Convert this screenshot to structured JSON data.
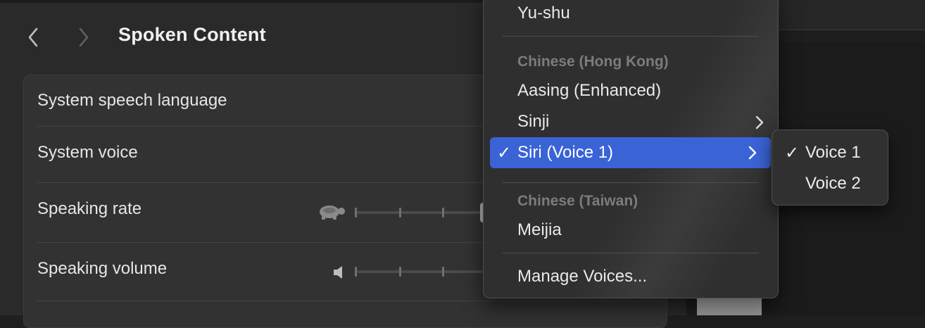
{
  "window": {
    "title": "Spoken Content",
    "back_icon": "chevron-left-icon",
    "forward_icon": "chevron-right-icon"
  },
  "settings": {
    "rows": [
      {
        "label": "System speech language"
      },
      {
        "label": "System voice"
      },
      {
        "label": "Speaking rate",
        "icon": "turtle-icon"
      },
      {
        "label": "Speaking volume",
        "icon": "speaker-icon"
      }
    ]
  },
  "voice_menu": {
    "items": [
      {
        "label": "Yu-shu",
        "type": "item"
      },
      {
        "label": "Chinese (Hong Kong)",
        "type": "header"
      },
      {
        "label": "Aasing (Enhanced)",
        "type": "item"
      },
      {
        "label": "Sinji",
        "type": "item",
        "submenu": true
      },
      {
        "label": "Siri (Voice 1)",
        "type": "item",
        "submenu": true,
        "checked": true,
        "highlighted": true
      },
      {
        "label": "Chinese (Taiwan)",
        "type": "header"
      },
      {
        "label": "Meijia",
        "type": "item"
      },
      {
        "label": "Manage Voices...",
        "type": "item"
      }
    ],
    "check_mark": "✓",
    "highlight_color": "#3a63d6"
  },
  "voice_submenu": {
    "items": [
      {
        "label": "Voice 1",
        "checked": true
      },
      {
        "label": "Voice 2",
        "checked": false
      }
    ]
  }
}
